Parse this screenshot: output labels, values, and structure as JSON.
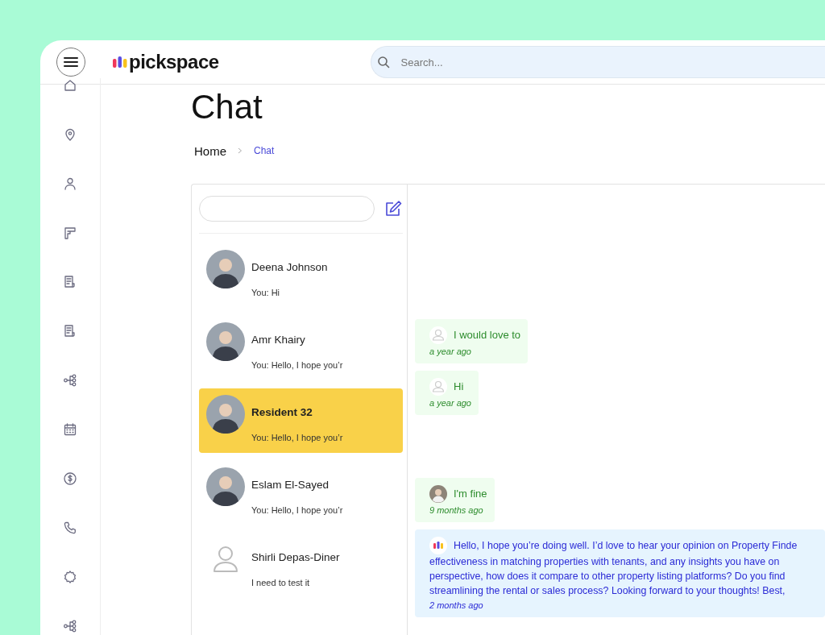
{
  "header": {
    "logo_text": "pickspace",
    "search": {
      "placeholder": "Search..."
    }
  },
  "page_title": "Chat",
  "breadcrumb": [
    {
      "label": "Home",
      "selected": false
    },
    {
      "label": "Chat",
      "selected": true
    }
  ],
  "contacts": [
    {
      "name": "Deena Johnson",
      "preview": "You: Hi",
      "avatar": {
        "kind": "photo"
      },
      "selected": false
    },
    {
      "name": "Amr Khairy",
      "preview": "You: Hello, I hope you’r",
      "avatar": {
        "kind": "photo"
      },
      "selected": false
    },
    {
      "name": "Resident 32",
      "preview": "You: Hello, I hope you’r",
      "avatar": {
        "kind": "photo"
      },
      "selected": true
    },
    {
      "name": "Eslam El-Sayed",
      "preview": "You: Hello, I hope you’r",
      "avatar": {
        "kind": "photo"
      },
      "selected": false
    },
    {
      "name": "Shirli Depas-Diner",
      "preview": "I need to test it",
      "avatar": {
        "kind": "placeholder"
      },
      "selected": false
    }
  ],
  "messages": [
    {
      "kind": "received",
      "avatar": {
        "kind": "placeholder"
      },
      "lines": [
        "I would love to"
      ],
      "time": "a year ago"
    },
    {
      "kind": "received",
      "avatar": {
        "kind": "placeholder"
      },
      "lines": [
        "Hi"
      ],
      "time": "a year ago"
    },
    {
      "kind": "received",
      "avatar": {
        "kind": "photo"
      },
      "lines": [
        "I'm fine"
      ],
      "time": "9 months ago"
    },
    {
      "kind": "sent",
      "avatar": {
        "kind": "logo"
      },
      "lines": [
        "Hello, I hope you’re doing well. I’d love to hear your opinion on Property Finde",
        "effectiveness in matching properties with tenants, and any insights you have on",
        "perspective, how does it compare to other property listing platforms? Do you find",
        "streamlining the rental or sales process? Looking forward to your thoughts! Best,"
      ],
      "time": "2 months ago"
    }
  ]
}
